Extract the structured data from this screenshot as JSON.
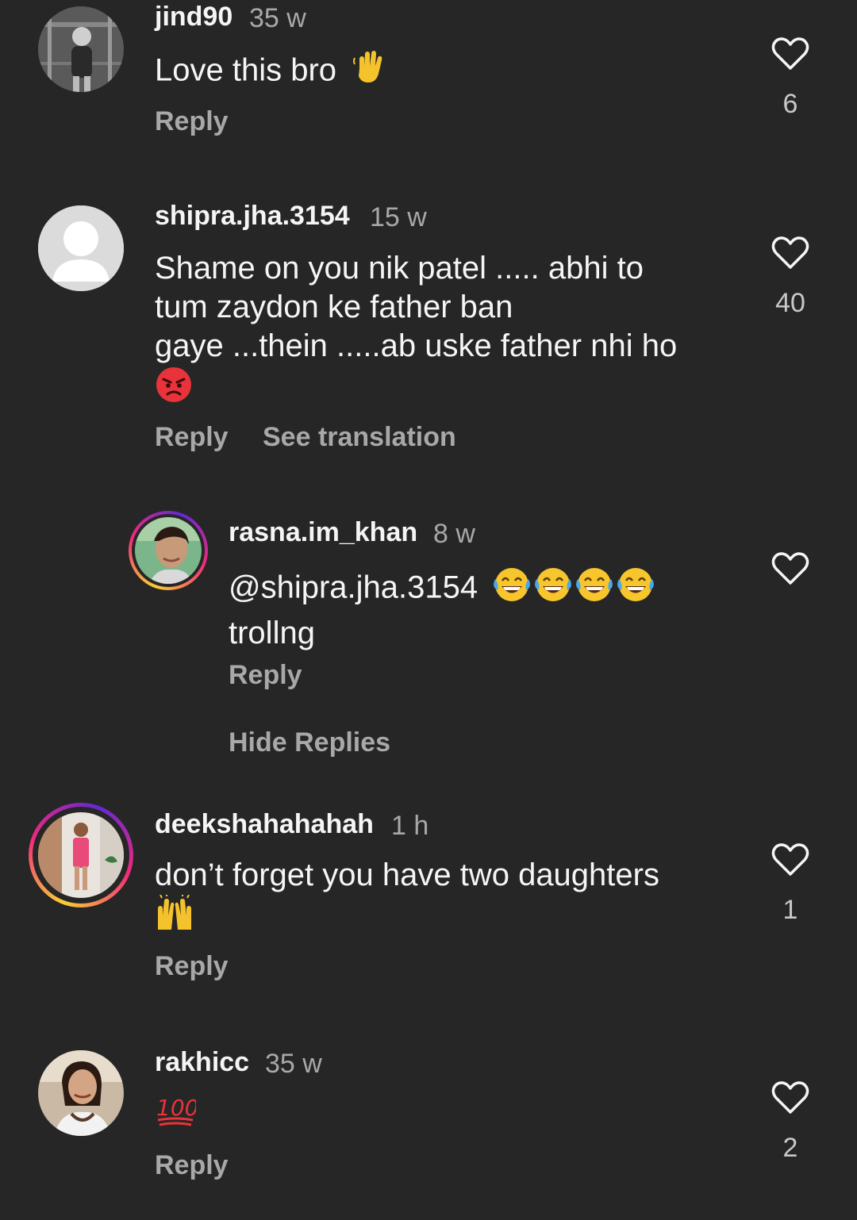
{
  "comments": [
    {
      "username": "jind90",
      "time": "35 w",
      "text": "Love this bro",
      "emoji_icon": "waving-hand-icon",
      "reply": "Reply",
      "likes": "6"
    },
    {
      "username": "shipra.jha.3154",
      "time": "15 w",
      "text_line1": "Shame on you nik patel ..... abhi to",
      "text_line2": "tum zaydon ke father ban",
      "text_line3": "gaye ...thein .....ab uske father nhi ho",
      "emoji_icon": "angry-face-icon",
      "reply": "Reply",
      "translate": "See translation",
      "likes": "40",
      "replies": [
        {
          "username": "rasna.im_khan",
          "time": "8 w",
          "mention": "@shipra.jha.3154",
          "emoji_icon": "tears-of-joy-icon",
          "text_line2": "trollng",
          "reply": "Reply"
        }
      ],
      "hide_replies": "Hide Replies"
    },
    {
      "username": "deekshahahahah",
      "time": "1 h",
      "text": "don’t forget you have two daughters",
      "emoji_icon": "raising-hands-icon",
      "reply": "Reply",
      "likes": "1"
    },
    {
      "username": "rakhicc",
      "time": "35 w",
      "emoji_icon": "hundred-points-icon",
      "reply": "Reply",
      "likes": "2"
    }
  ],
  "colors": {
    "background": "#262626",
    "primary_text": "#f5f5f5",
    "secondary_text": "#a8a8a8",
    "story_ring": [
      "#f9ce34",
      "#ee2a7b",
      "#6228d7"
    ]
  }
}
